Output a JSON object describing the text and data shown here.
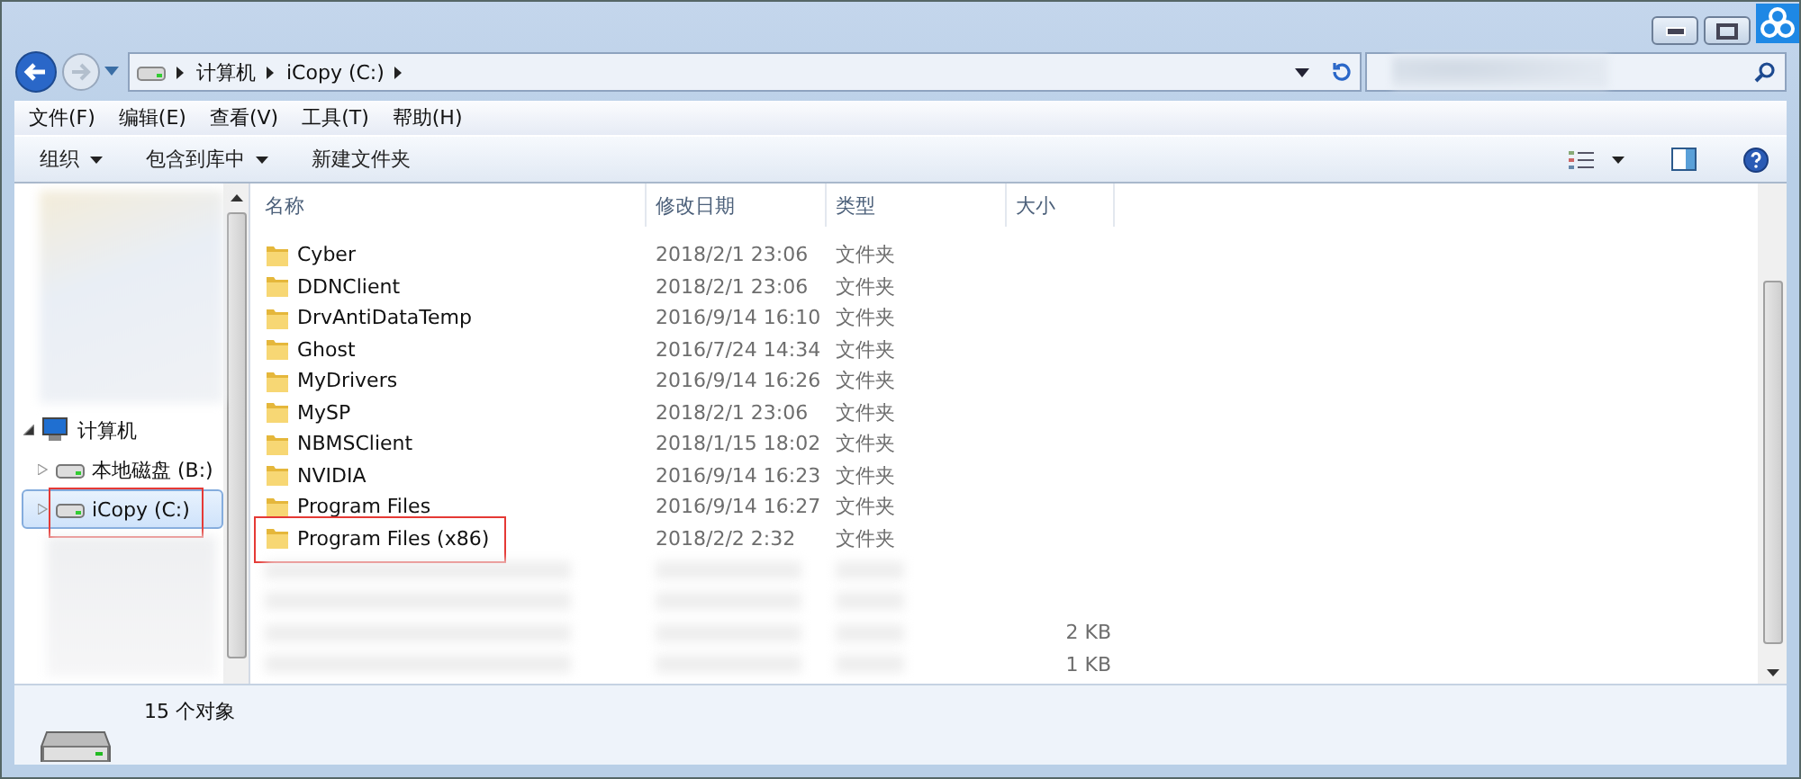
{
  "address_bar": {
    "breadcrumbs": [
      "计算机",
      "iCopy (C:)"
    ]
  },
  "menu_bar": [
    "文件(F)",
    "编辑(E)",
    "查看(V)",
    "工具(T)",
    "帮助(H)"
  ],
  "toolbar": [
    {
      "label": "组织",
      "dropdown": true
    },
    {
      "label": "包含到库中",
      "dropdown": true
    },
    {
      "label": "新建文件夹",
      "dropdown": false
    }
  ],
  "navigation": [
    {
      "label": "计算机",
      "expanded": true,
      "selected": false,
      "annotated": false,
      "children": [
        {
          "label": "本地磁盘 (B:)",
          "expanded": false,
          "selected": false,
          "annotated": false
        },
        {
          "label": "iCopy (C:)",
          "expanded": false,
          "selected": true,
          "annotated": true
        }
      ]
    }
  ],
  "columns": [
    "名称",
    "修改日期",
    "类型",
    "大小"
  ],
  "rows": [
    {
      "kind": "folder",
      "name": "Cyber",
      "date": "2018/2/1 23:06",
      "type": "文件夹",
      "annotated": false
    },
    {
      "kind": "folder",
      "name": "DDNClient",
      "date": "2018/2/1 23:06",
      "type": "文件夹",
      "annotated": false
    },
    {
      "kind": "folder",
      "name": "DrvAntiDataTemp",
      "date": "2016/9/14 16:10",
      "type": "文件夹",
      "annotated": false
    },
    {
      "kind": "folder",
      "name": "Ghost",
      "date": "2016/7/24 14:34",
      "type": "文件夹",
      "annotated": false
    },
    {
      "kind": "folder",
      "name": "MyDrivers",
      "date": "2016/9/14 16:26",
      "type": "文件夹",
      "annotated": false
    },
    {
      "kind": "folder",
      "name": "MySP",
      "date": "2018/2/1 23:06",
      "type": "文件夹",
      "annotated": false
    },
    {
      "kind": "folder",
      "name": "NBMSClient",
      "date": "2018/1/15 18:02",
      "type": "文件夹",
      "annotated": false
    },
    {
      "kind": "folder",
      "name": "NVIDIA",
      "date": "2016/9/14 16:23",
      "type": "文件夹",
      "annotated": false
    },
    {
      "kind": "folder",
      "name": "Program Files",
      "date": "2016/9/14 16:27",
      "type": "文件夹",
      "annotated": false
    },
    {
      "kind": "folder",
      "name": "Program Files (x86)",
      "date": "2018/2/2 2:32",
      "type": "文件夹",
      "annotated": true
    },
    {
      "kind": "blurred"
    },
    {
      "kind": "blurred"
    },
    {
      "kind": "blurred",
      "size": "2 KB"
    },
    {
      "kind": "blurred",
      "size": "1 KB"
    }
  ],
  "status_bar": {
    "count": "15 个对象"
  }
}
